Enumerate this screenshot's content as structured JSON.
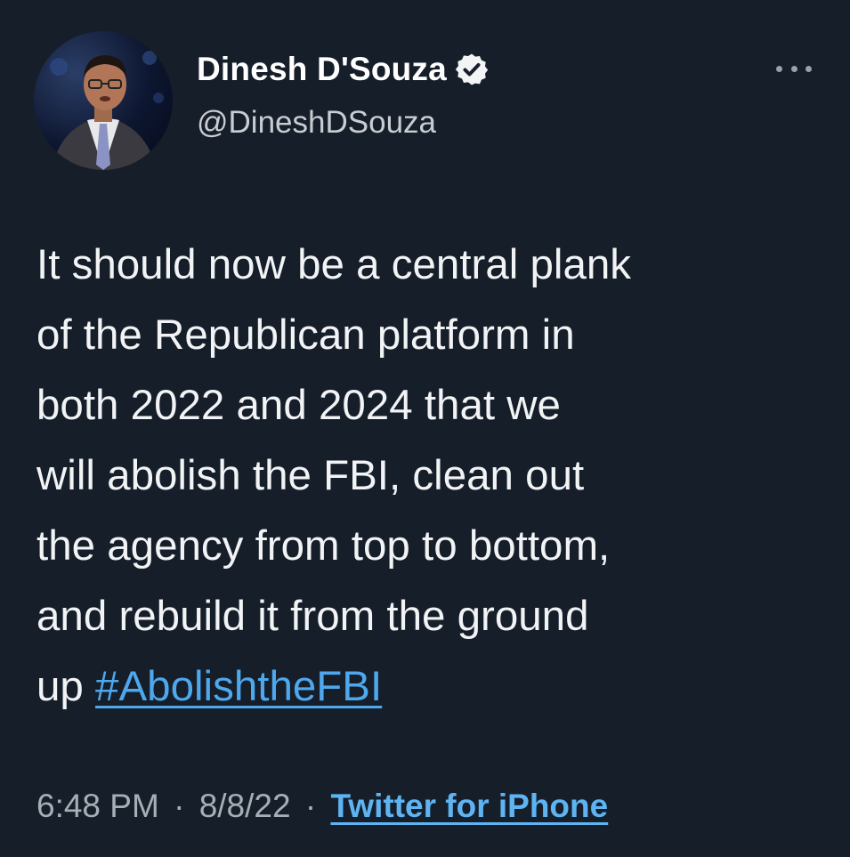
{
  "tweet": {
    "author": {
      "display_name": "Dinesh D'Souza",
      "handle": "@DineshDSouza",
      "verified": true,
      "avatar_icon": "profile-photo"
    },
    "more_icon": "more-dots-icon",
    "text_before_hashtag": "It should now be a central plank\nof the Republican platform in\nboth 2022 and 2024 that we\nwill abolish the FBI, clean out\nthe agency from top to bottom,\nand rebuild it from the ground\nup ",
    "hashtag": "#AbolishtheFBI",
    "meta": {
      "time": "6:48 PM",
      "separator": "·",
      "date": "8/8/22",
      "source": "Twitter for iPhone"
    }
  },
  "colors": {
    "background": "#161e2a",
    "text": "#f1f3f5",
    "secondary_text": "#a8aeb5",
    "link": "#4ea8ee"
  }
}
